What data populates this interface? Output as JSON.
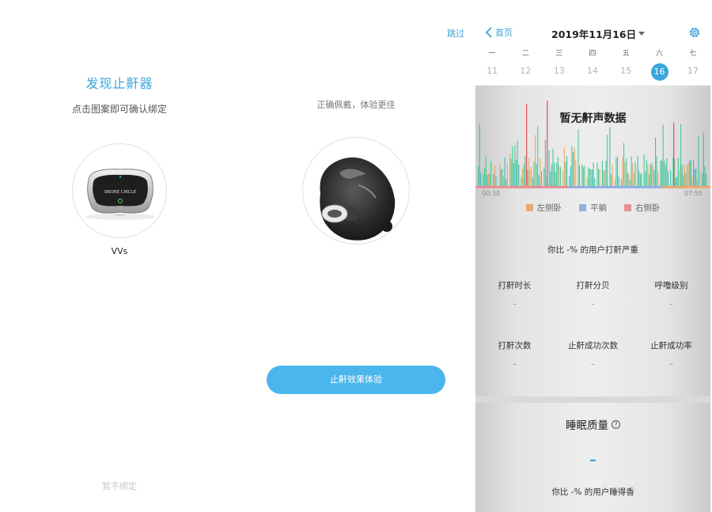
{
  "screen1": {
    "title": "发现止鼾器",
    "subtitle": "点击图案即可确认绑定",
    "device_name": "VVs",
    "device_label": "SNORE CIRCLE",
    "skip_bind": "暂不绑定"
  },
  "screen2": {
    "skip": "跳过",
    "hint": "正确佩戴，体验更佳",
    "try_button": "止鼾效果体验"
  },
  "screen3": {
    "back_label": "首页",
    "date": "2019年11月16日",
    "weekday_names": [
      "一",
      "二",
      "三",
      "四",
      "五",
      "六",
      "七"
    ],
    "days": [
      "11",
      "12",
      "13",
      "14",
      "15",
      "16",
      "17"
    ],
    "selected_day": "16",
    "chart_title": "暂无鼾声数据",
    "time_start": "00:30",
    "time_end": "07:55",
    "legend": [
      {
        "label": "左侧卧",
        "color": "#e8a971"
      },
      {
        "label": "平躺",
        "color": "#8fb1e4"
      },
      {
        "label": "右侧卧",
        "color": "#e88e96"
      }
    ],
    "compare_snore": "你比 -% 的用户打鼾严重",
    "stats": [
      {
        "label": "打鼾时长",
        "value": "–"
      },
      {
        "label": "打鼾分贝",
        "value": "–"
      },
      {
        "label": "呼噜级别",
        "value": "–"
      },
      {
        "label": "打鼾次数",
        "value": "–"
      },
      {
        "label": "止鼾成功次数",
        "value": "–"
      },
      {
        "label": "止鼾成功率",
        "value": "–"
      }
    ],
    "sleep_quality_title": "睡眠质量",
    "help_symbol": "?",
    "sleep_quality_value": "–",
    "compare_sleep": "你比 -% 的用户睡得香"
  },
  "colors": {
    "accent": "#3aa6dc",
    "button": "#4ab6ec",
    "bar_orange": "#e8a04a",
    "bar_green": "#2cc48a",
    "bar_teal": "#22b8a6",
    "bar_red": "#e05a60"
  }
}
